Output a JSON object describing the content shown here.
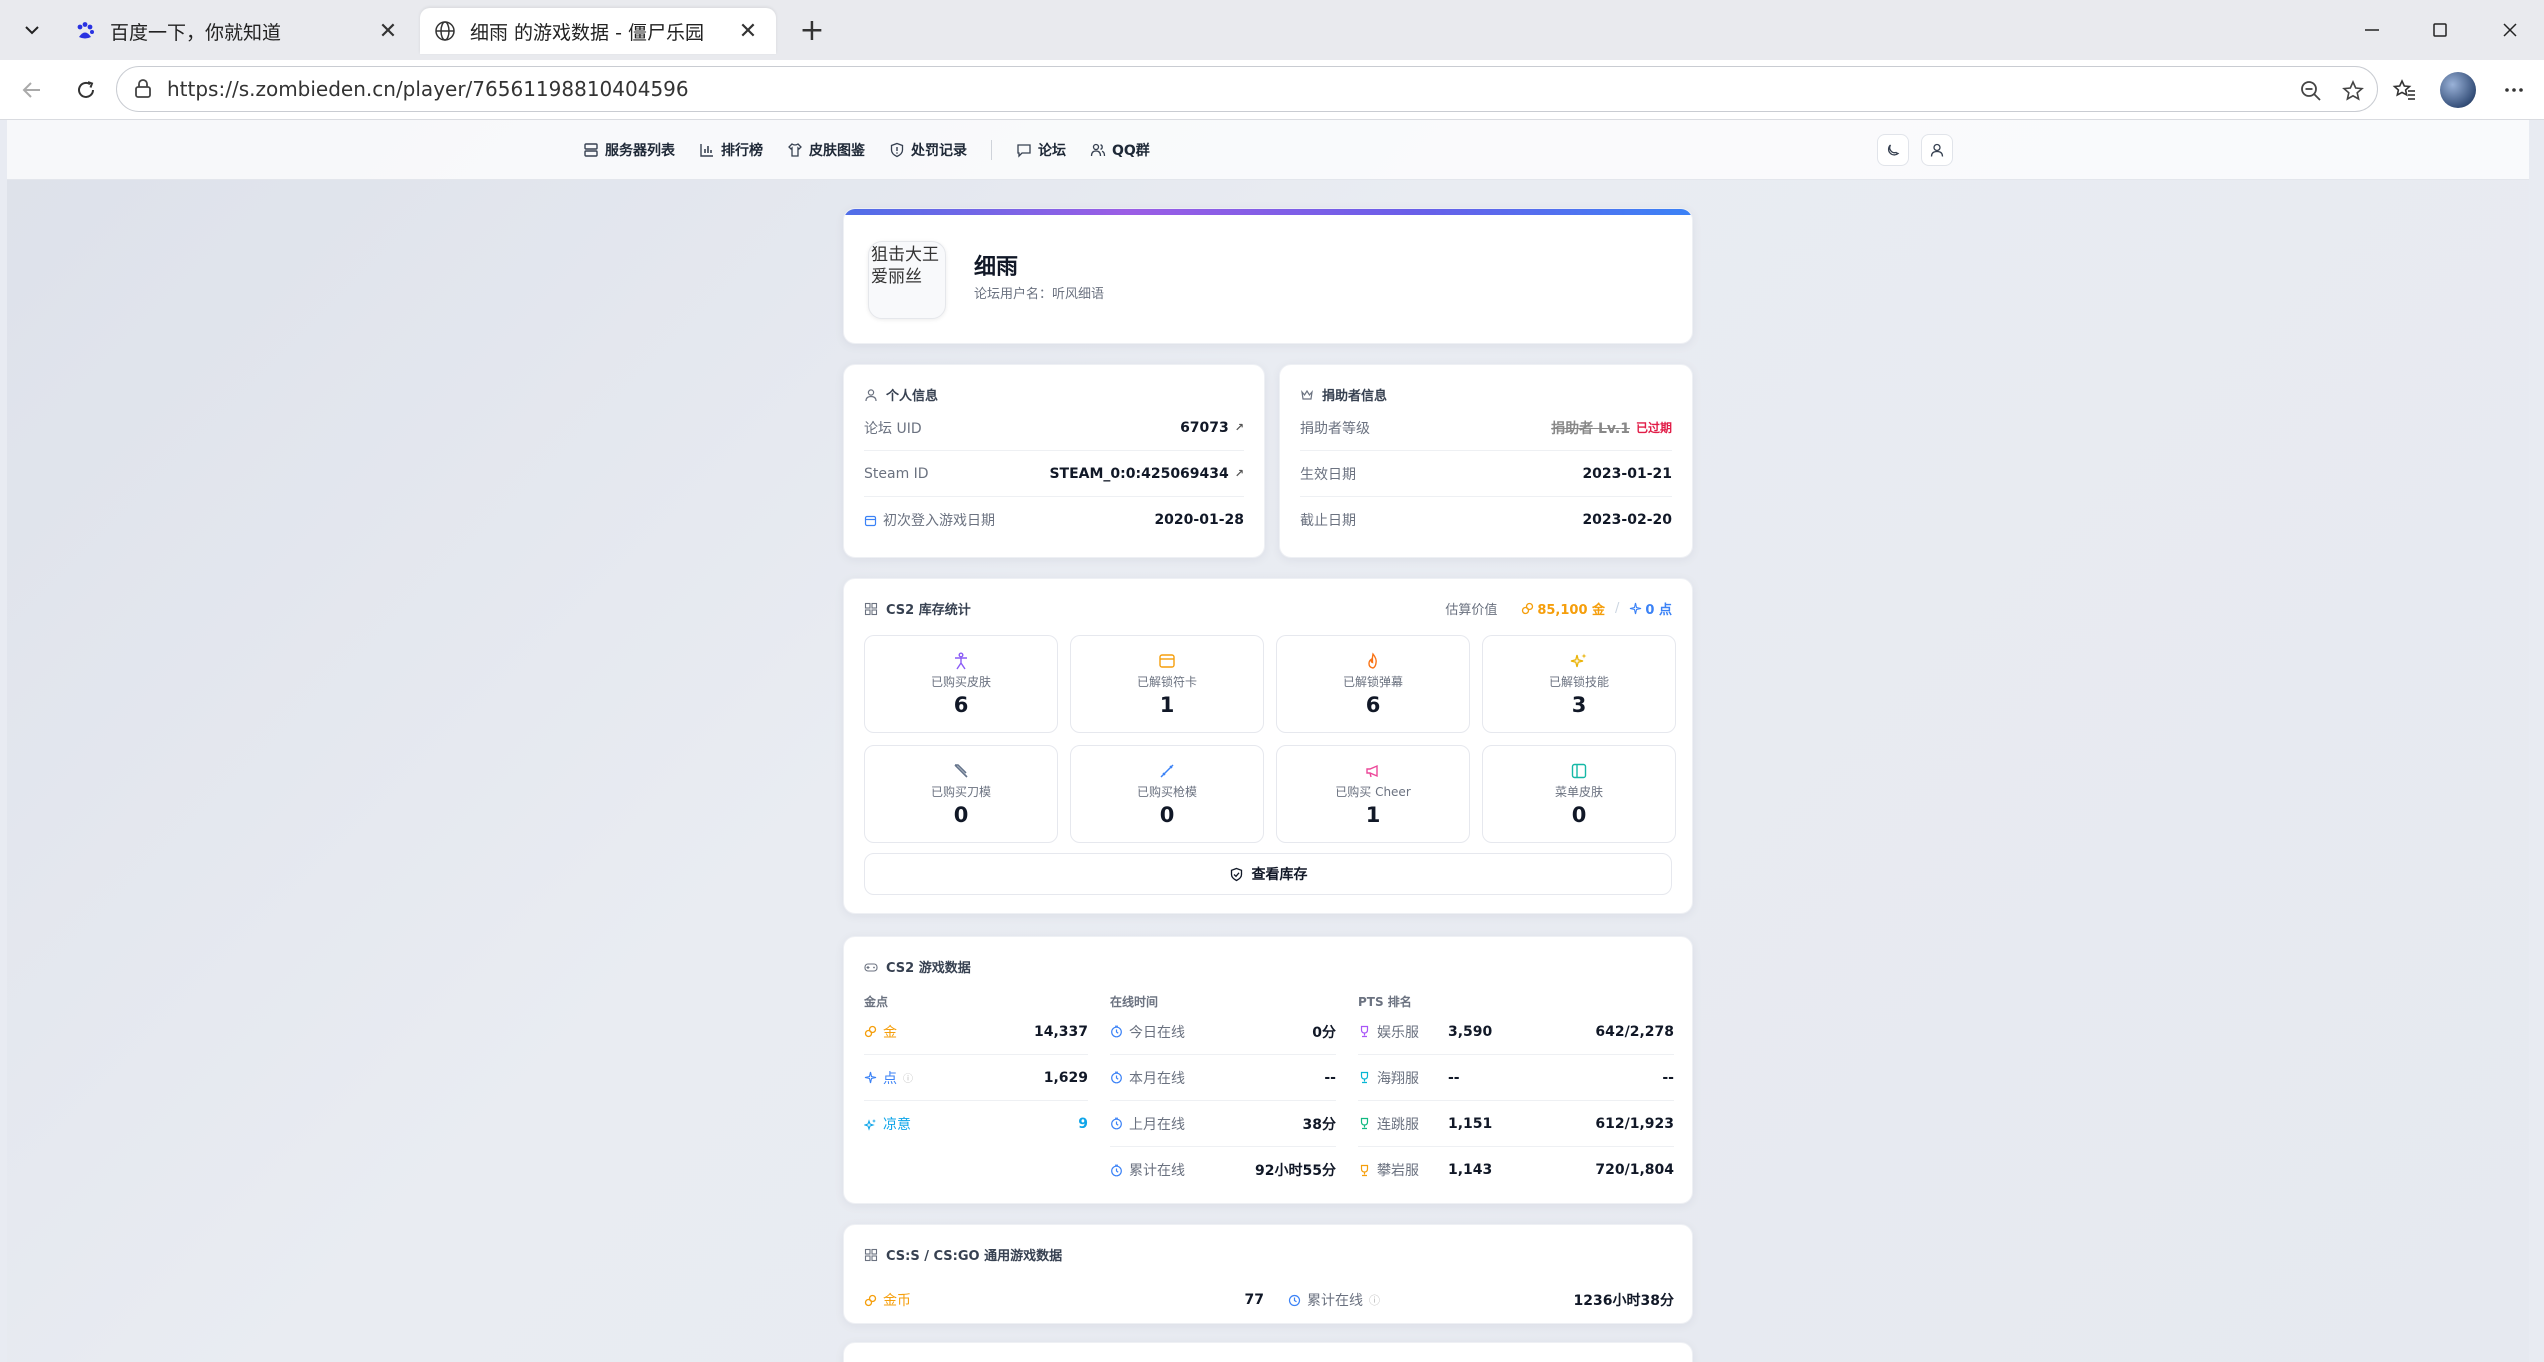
{
  "browser": {
    "tabs": [
      {
        "title": "百度一下，你就知道",
        "active": false
      },
      {
        "title": "细雨 的游戏数据 - 僵尸乐园",
        "active": true
      }
    ],
    "url": "https://s.zombieden.cn/player/76561198810404596"
  },
  "nav": {
    "items": [
      {
        "label": "服务器列表",
        "icon": "server-icon"
      },
      {
        "label": "排行榜",
        "icon": "bar-chart-icon"
      },
      {
        "label": "皮肤图鉴",
        "icon": "shirt-icon"
      },
      {
        "label": "处罚记录",
        "icon": "shield-icon"
      },
      {
        "label": "论坛",
        "icon": "chat-icon"
      },
      {
        "label": "QQ群",
        "icon": "users-icon"
      }
    ]
  },
  "profile": {
    "avatar_alt": "狙击大王爱丽丝",
    "name": "细雨",
    "forum_username": "论坛用户名：听风细语"
  },
  "personal": {
    "title": "个人信息",
    "rows": [
      {
        "label": "论坛 UID",
        "value": "67073"
      },
      {
        "label": "Steam ID",
        "value": "STEAM_0:0:425069434"
      },
      {
        "label": "初次登入游戏日期",
        "value": "2020-01-28"
      }
    ]
  },
  "donor": {
    "title": "捐助者信息",
    "rows": [
      {
        "label": "捐助者等级",
        "value": "捐助者 Lv.1",
        "status": "已过期"
      },
      {
        "label": "生效日期",
        "value": "2023-01-21"
      },
      {
        "label": "截止日期",
        "value": "2023-02-20"
      }
    ]
  },
  "inventory": {
    "title": "CS2 库存统计",
    "estimate_label": "估算价值",
    "gold_value": "85,100 金",
    "separator": "/",
    "point_value": "0 点",
    "tiles": [
      {
        "label": "已购买皮肤",
        "value": "6",
        "icon": "person-icon",
        "color": "#8b5cf6"
      },
      {
        "label": "已解锁符卡",
        "value": "1",
        "icon": "card-icon",
        "color": "#f59e0b"
      },
      {
        "label": "已解锁弹幕",
        "value": "6",
        "icon": "flame-icon",
        "color": "#f97316"
      },
      {
        "label": "已解锁技能",
        "value": "3",
        "icon": "sparkles-icon",
        "color": "#eab308"
      },
      {
        "label": "已购买刀模",
        "value": "0",
        "icon": "knife-icon",
        "color": "#64748b"
      },
      {
        "label": "已购买枪模",
        "value": "0",
        "icon": "gun-icon",
        "color": "#3b82f6"
      },
      {
        "label": "已购买 Cheer",
        "value": "1",
        "icon": "megaphone-icon",
        "color": "#ec4899"
      },
      {
        "label": "菜单皮肤",
        "value": "0",
        "icon": "panel-icon",
        "color": "#14b8a6"
      }
    ],
    "view_button": "查看库存"
  },
  "game": {
    "title": "CS2 游戏数据",
    "gold_head": "金点",
    "online_head": "在线时间",
    "pts_head": "PTS 排名",
    "gold_rows": [
      {
        "label": "金",
        "value": "14,337",
        "color": "#f59e0b"
      },
      {
        "label": "点",
        "value": "1,629",
        "color": "#3b82f6"
      },
      {
        "label": "凉意",
        "value": "9",
        "color": "#0ea5e9"
      }
    ],
    "online_rows": [
      {
        "label": "今日在线",
        "value": "0分"
      },
      {
        "label": "本月在线",
        "value": "--"
      },
      {
        "label": "上月在线",
        "value": "38分"
      },
      {
        "label": "累计在线",
        "value": "92小时55分"
      }
    ],
    "pts_rows": [
      {
        "label": "娱乐服",
        "score": "3,590",
        "rank": "642/2,278",
        "color": "#a855f7"
      },
      {
        "label": "海翔服",
        "score": "--",
        "rank": "--",
        "color": "#06b6d4"
      },
      {
        "label": "连跳服",
        "score": "1,151",
        "rank": "612/1,923",
        "color": "#10b981"
      },
      {
        "label": "攀岩服",
        "score": "1,143",
        "rank": "720/1,804",
        "color": "#f59e0b"
      }
    ]
  },
  "legacy": {
    "title": "CS:S / CS:GO 通用游戏数据",
    "coin_label": "金币",
    "coin_value": "77",
    "online_label": "累计在线",
    "online_value": "1236小时38分"
  }
}
